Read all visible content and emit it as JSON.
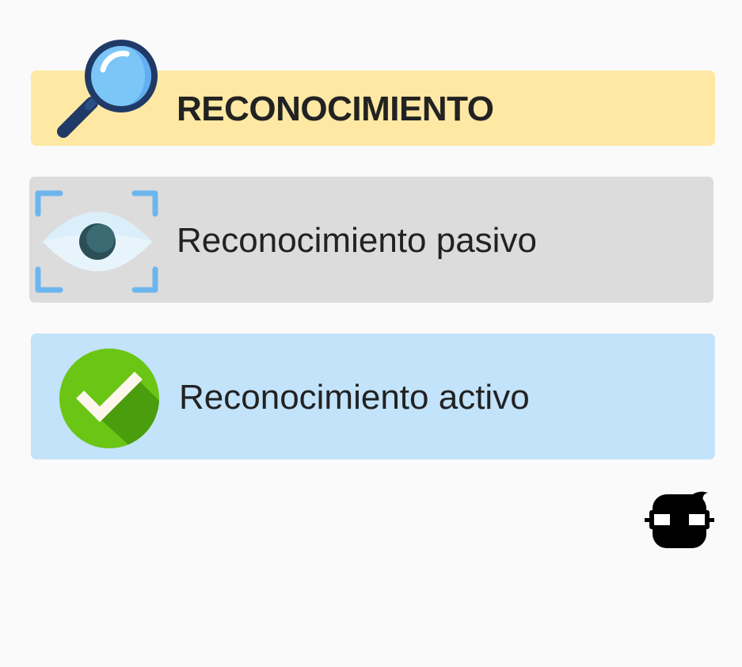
{
  "header": {
    "title": "RECONOCIMIENTO",
    "icon": "magnifier-icon",
    "background": "#ffe8a3"
  },
  "items": [
    {
      "label": "Reconocimiento pasivo",
      "icon": "eye-icon",
      "background": "#dcdcdc"
    },
    {
      "label": "Reconocimiento activo",
      "icon": "checkmark-icon",
      "background": "#c2e3fa"
    }
  ],
  "footer": {
    "icon": "mascot-glasses-icon"
  }
}
